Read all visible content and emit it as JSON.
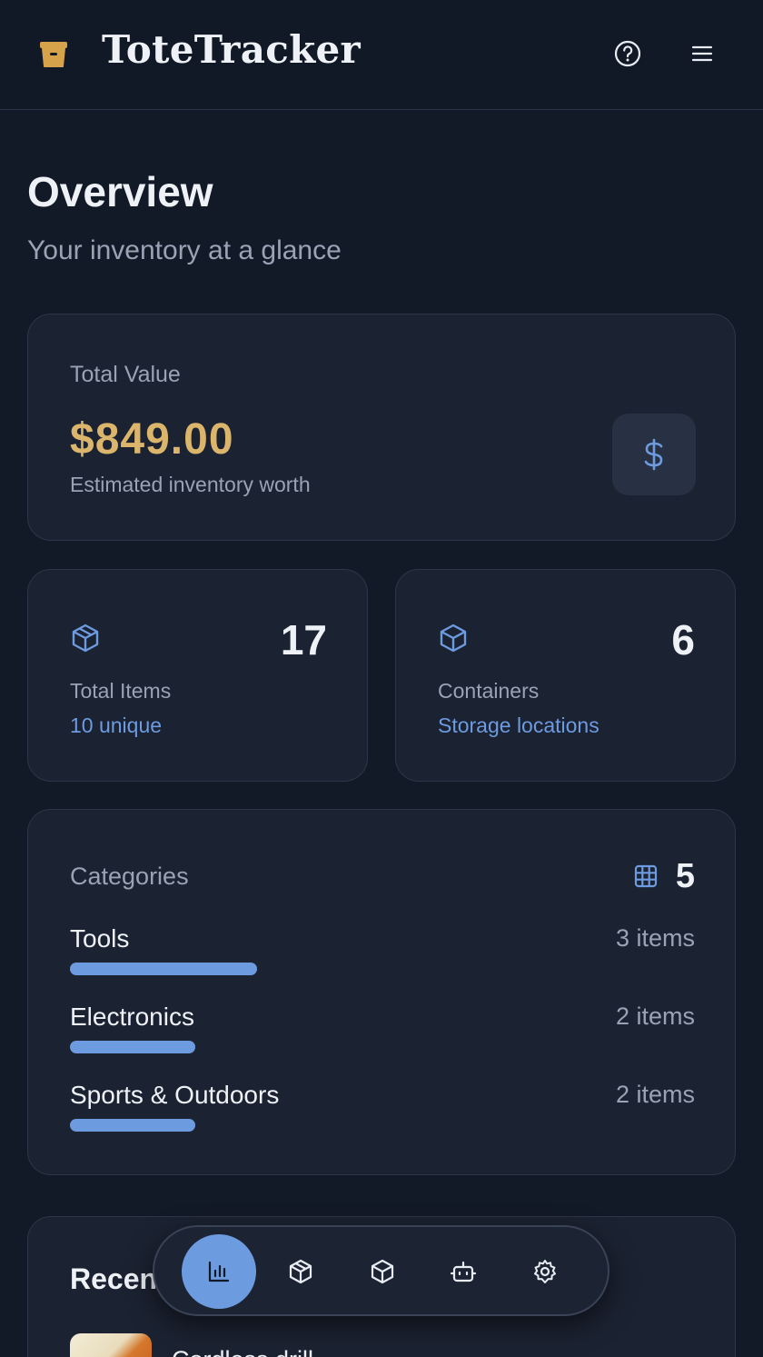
{
  "app": {
    "title": "ToteTracker"
  },
  "header": {
    "help_icon": "help-circle-icon",
    "menu_icon": "hamburger-menu-icon"
  },
  "overview": {
    "title": "Overview",
    "subtitle": "Your inventory at a glance"
  },
  "total_value": {
    "label": "Total Value",
    "amount": "$849.00",
    "caption": "Estimated inventory worth",
    "icon": "dollar-icon"
  },
  "stats": {
    "items": {
      "number": "17",
      "label": "Total Items",
      "link": "10 unique",
      "icon": "package-icon"
    },
    "containers": {
      "number": "6",
      "label": "Containers",
      "link": "Storage locations",
      "icon": "box-icon"
    }
  },
  "categories": {
    "title": "Categories",
    "count": "5",
    "icon": "grid-icon",
    "rows": [
      {
        "name": "Tools",
        "qty": "3 items",
        "fraction": 0.3
      },
      {
        "name": "Electronics",
        "qty": "2 items",
        "fraction": 0.2
      },
      {
        "name": "Sports & Outdoors",
        "qty": "2 items",
        "fraction": 0.2
      }
    ]
  },
  "recent": {
    "title": "Recent",
    "first_item": "Cordless drill"
  },
  "nav": {
    "items": [
      {
        "icon": "bar-chart-icon",
        "active": true
      },
      {
        "icon": "package-icon",
        "active": false
      },
      {
        "icon": "box-icon",
        "active": false
      },
      {
        "icon": "robot-icon",
        "active": false
      },
      {
        "icon": "settings-gear-icon",
        "active": false
      }
    ]
  },
  "colors": {
    "accent": "#6d9be0",
    "gold": "#dcb56c",
    "background": "#131a27",
    "card": "#1b2231"
  }
}
